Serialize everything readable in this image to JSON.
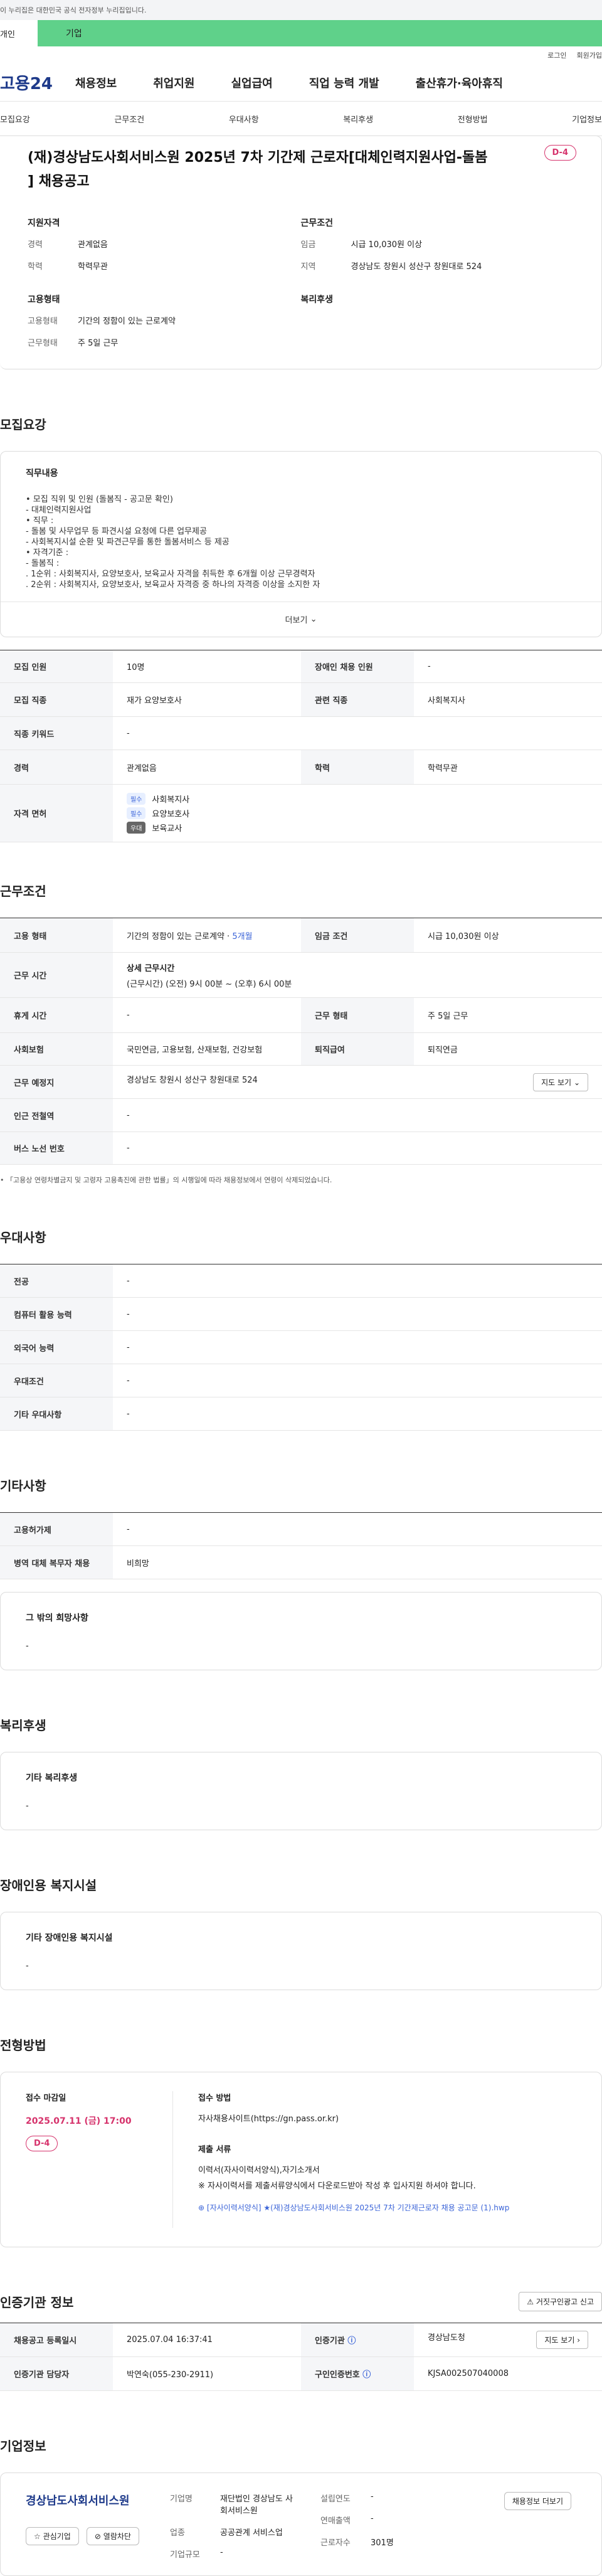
{
  "topbar": {
    "gov_notice": "이 누리집은 대한민국 공식 전자정부 누리집입니다."
  },
  "tabs": {
    "person": "개인",
    "biz": "기업"
  },
  "util": {
    "login": "로그인",
    "join": "회원가입"
  },
  "gnb": {
    "logo": "고용24",
    "items": [
      "채용정보",
      "취업지원",
      "실업급여",
      "직업 능력 개발",
      "출산휴가·육아휴직"
    ]
  },
  "subnav": [
    "모집요강",
    "근무조건",
    "우대사항",
    "복리후생",
    "전형방법",
    "기업정보"
  ],
  "job": {
    "title": "(재)경상남도사회서비스원 2025년 7차 기간제 근로자[대체인력지원사업-돌봄 ] 채용공고",
    "dday": "D-4",
    "qual_h": "지원자격",
    "cond_h": "근무조건",
    "career_k": "경력",
    "career_v": "관계없음",
    "edu_k": "학력",
    "edu_v": "학력무관",
    "wage_k": "임금",
    "wage_v": "시급 10,030원 이상",
    "region_k": "지역",
    "region_v": "경상남도 창원시 성산구 창원대로 524",
    "emp_h": "고용형태",
    "welfare_h": "복리후생",
    "emptype_k": "고용형태",
    "emptype_v": "기간의 정함이 있는 근로계약",
    "hours_k": "근무형태",
    "hours_v": "주 5일 근무"
  },
  "recruit": {
    "section": "모집요강",
    "desc_h": "직무내용",
    "desc": "• 모집 직위 및 인원 (돌봄직 - 공고문 확인)\n- 대체인력지원사업\n• 직무 :\n- 돌봄 및 사무업무 등 파견시설 요청에 다른 업무제공\n- 사회복지시설 순환 및 파견근무를 통한 돌봄서비스 등 제공\n• 자격기준 :\n- 돌봄직 :\n. 1순위 : 사회복지사, 요양보호사, 보육교사 자격을 취득한 후 6개월 이상 근무경력자\n. 2순위 : 사회복지사, 요양보호사, 보육교사 자격증 중 하나의 자격증 이상을 소지한 자",
    "more": "더보기",
    "rows": {
      "count_k": "모집 인원",
      "count_v": "10명",
      "disabled_k": "장애인 채용 인원",
      "disabled_v": "-",
      "job_k": "모집 직종",
      "job_v": "재가 요양보호사",
      "rel_k": "관련 직종",
      "rel_v": "사회복지사",
      "kw_k": "직종 키워드",
      "kw_v": "-",
      "career_k": "경력",
      "career_v": "관계없음",
      "edu_k": "학력",
      "edu_v": "학력무관",
      "lic_k": "자격 면허",
      "licenses": [
        {
          "badge": "필수",
          "name": "사회복지사"
        },
        {
          "badge": "필수",
          "name": "요양보호사"
        },
        {
          "badge": "우대",
          "name": "보육교사"
        }
      ]
    }
  },
  "cond": {
    "section": "근무조건",
    "emp_k": "고용 형태",
    "emp_v": "기간의 정함이 있는 근로계약 · ",
    "emp_hl": "5개월",
    "wage_k": "임금 조건",
    "wage_v": "시급 10,030원 이상",
    "time_k": "근무 시간",
    "time_h": "상세 근무시간",
    "time_v": "(근무시간) (오전) 9시 00분 ~ (오후) 6시 00분",
    "break_k": "휴게 시간",
    "break_v": "-",
    "shift_k": "근무 형태",
    "shift_v": "주 5일 근무",
    "ins_k": "사회보험",
    "ins_v": "국민연금, 고용보험, 산재보험, 건강보험",
    "sev_k": "퇴직급여",
    "sev_v": "퇴직연금",
    "place_k": "근무 예정지",
    "place_v": "경상남도 창원시 성산구 창원대로 524",
    "map": "지도 보기",
    "subway_k": "인근 전철역",
    "subway_v": "-",
    "bus_k": "버스 노선 번호",
    "bus_v": "-",
    "note": "• 「고용상 연령차별금지 및 고령자 고용촉진에 관한 법률」의 시행일에 따라 채용정보에서 연령이 삭제되었습니다."
  },
  "pref": {
    "section": "우대사항",
    "rows": [
      [
        "전공",
        "-"
      ],
      [
        "컴퓨터 활용 능력",
        "-"
      ],
      [
        "외국어 능력",
        "-"
      ],
      [
        "우대조건",
        "-"
      ],
      [
        "기타 우대사항",
        "-"
      ]
    ]
  },
  "etc": {
    "section": "기타사항",
    "rows": [
      [
        "고용허가제",
        "-"
      ],
      [
        "병역 대체 복무자 채용",
        "비희망"
      ]
    ],
    "other_h": "그 밖의 희망사항",
    "other_v": "-"
  },
  "welfare": {
    "section": "복리후생",
    "h": "기타 복리후생",
    "v": "-"
  },
  "disability": {
    "section": "장애인용 복지시설",
    "h": "기타 장애인용 복지시설",
    "v": "-"
  },
  "apply": {
    "section": "전형방법",
    "deadline_h": "접수 마감일",
    "deadline_v": "2025.07.11 (금) 17:00",
    "dday": "D-4",
    "method_h": "접수 방법",
    "method_v": "자사채용사이트(https://gn.pass.or.kr)",
    "docs_h": "제출 서류",
    "docs_v1": "이력서(자사이력서양식),자기소개서",
    "docs_v2": "※ 자사이력서를 제출서류양식에서 다운로드받아 작성 후 입사지원 하셔야 합니다.",
    "file": "[자사이력서양식] ★(재)경상남도사회서비스원 2025년 7차 기간제근로자 채용 공고문 (1).hwp"
  },
  "cert": {
    "section": "인증기관 정보",
    "report": "거짓구인광고 신고",
    "reg_k": "채용공고 등록일시",
    "reg_v": "2025.07.04 16:37:41",
    "org_k": "인증기관",
    "org_v": "경상남도청",
    "map": "지도 보기",
    "mgr_k": "인증기관 담당자",
    "mgr_v": "박연숙(055-230-2911)",
    "num_k": "구인인증번호",
    "num_v": "KJSA002507040008"
  },
  "company": {
    "section": "기업정보",
    "logo_text": "경상남도사회서비스원",
    "fav": "관심기업",
    "block": "열람차단",
    "name_k": "기업명",
    "name_v": "재단법인 경상남도 사회서비스원",
    "ind_k": "업종",
    "ind_v": "공공관계 서비스업",
    "size_k": "기업규모",
    "size_v": "-",
    "est_k": "설립연도",
    "est_v": "-",
    "sales_k": "연매출액",
    "sales_v": "-",
    "emp_k": "근로자수",
    "emp_v": "301명",
    "jobs_btn": "채용정보 더보기"
  }
}
